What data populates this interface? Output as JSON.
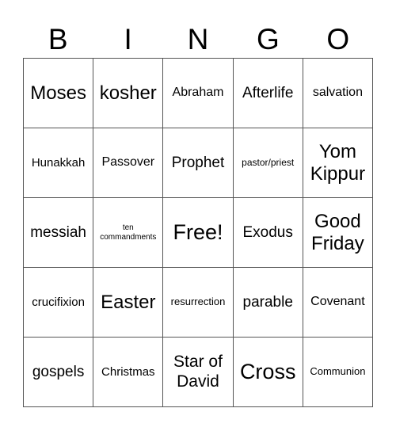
{
  "header": [
    "B",
    "I",
    "N",
    "G",
    "O"
  ],
  "cells": [
    [
      "Moses",
      "kosher",
      "Abraham",
      "Afterlife",
      "salvation"
    ],
    [
      "Hunakkah",
      "Passover",
      "Prophet",
      "pastor/priest",
      "Yom Kippur"
    ],
    [
      "messiah",
      "ten commandments",
      "Free!",
      "Exodus",
      "Good Friday"
    ],
    [
      "crucifixion",
      "Easter",
      "resurrection",
      "parable",
      "Covenant"
    ],
    [
      "gospels",
      "Christmas",
      "Star of David",
      "Cross",
      "Communion"
    ]
  ]
}
